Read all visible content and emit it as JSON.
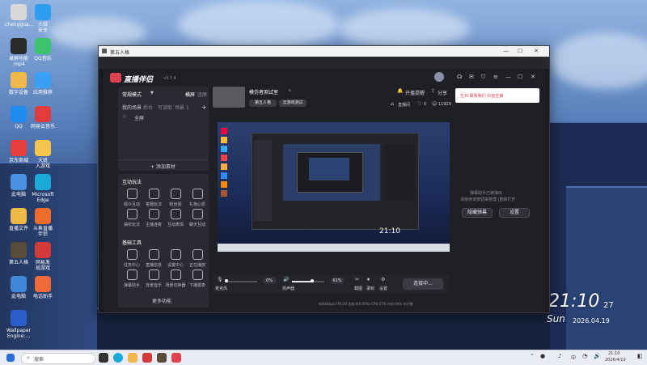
{
  "desktop": {
    "icons": [
      {
        "label": "chenggua...",
        "color": "#d8d8d8"
      },
      {
        "label": "火绒\n安全",
        "color": "#2f9ef0"
      },
      {
        "label": "录屏功能\n.mp4",
        "color": "#2a2a2a"
      },
      {
        "label": "QQ音乐",
        "color": "#3bc46b"
      },
      {
        "label": "数字设备",
        "color": "#f2b84b"
      },
      {
        "label": "应用推荐",
        "color": "#3aa0f5"
      },
      {
        "label": "QQ",
        "color": "#1e8bf0"
      },
      {
        "label": "网易云音乐",
        "color": "#e23c3c"
      },
      {
        "label": "京东商城",
        "color": "#e83e3e"
      },
      {
        "label": "大班\n入游戏",
        "color": "#f7c54c"
      },
      {
        "label": "此电脑",
        "color": "#4a90e0"
      },
      {
        "label": "Microsoft\nEdge",
        "color": "#1aa9d8"
      },
      {
        "label": "直播文件",
        "color": "#f0b848"
      },
      {
        "label": "斗鱼直播\n伴侣",
        "color": "#f06c2a"
      },
      {
        "label": "第五人格",
        "color": "#5a4a3a"
      },
      {
        "label": "网易发\n现游戏",
        "color": "#d43a3a"
      },
      {
        "label": "此电脑",
        "color": "#3d86d8"
      },
      {
        "label": "电话助手",
        "color": "#f06a3a"
      },
      {
        "label": "Wallpaper\nEngine:...",
        "color": "#2b5ec8"
      }
    ],
    "clock": {
      "time": "21:10",
      "day": "Sun",
      "date_num": "27",
      "date": "2026.04.19"
    }
  },
  "window": {
    "title": "第五人格",
    "app": {
      "name": "直播伴侣",
      "version": "v3.7.4",
      "left_panel": {
        "scene_title": "常规模式",
        "switch": "横屏",
        "switch2": "竖屏",
        "tabs": [
          "我的场景",
          "后台",
          "可读取",
          "场景 1"
        ],
        "sources_item": "全屏",
        "add_source": "+ 添加素材",
        "interact_title": "互动玩法",
        "interact_tools": [
          "观众互动",
          "答题玩法",
          "粉丝团",
          "礼物心愿",
          "抽奖玩法",
          "主播连麦",
          "互动表情",
          "聊天互动"
        ],
        "basic_title": "基础工具",
        "basic_tools": [
          "任务中心",
          "直播信息",
          "设置中心",
          "正在播放",
          "弹幕助手",
          "背景音乐",
          "场景切换器",
          "下播报表"
        ],
        "more": "更多功能"
      },
      "stream_info": {
        "title": "模仿者测试室",
        "tag1": "第五人格",
        "tag2": "云游戏测试",
        "live_reminder": "开播提醒",
        "share": "分享",
        "room_label": "直播间",
        "likes": "0",
        "viewers": "11929"
      },
      "controls": {
        "mic_label": "麦克风",
        "mic_value": "0%",
        "speaker_label": "扬声器",
        "speaker_value": "61%",
        "screenshot": "截图",
        "record": "录制",
        "settings": "设置",
        "golive": "连接中...",
        "status": "码率0kbps  FPS:30  丢帧:0(0.00%)  CPU:15%  内存:64%  未开播"
      },
      "right_panel": {
        "card_text": "生日:联系我们 抖音主播",
        "notice": "弹幕助手已被弹出",
        "notice2": "请使用该按钮来管理 |重新打开",
        "btn1": "隐藏弹幕",
        "btn2": "设置"
      }
    }
  },
  "taskbar": {
    "search": "搜索",
    "time": "21:10",
    "date": "2026/4/19",
    "lang": "中"
  },
  "colors": {
    "accent": "#e0434f",
    "primary_btn": "#3a3b44",
    "app_bg": "#1f2026"
  }
}
